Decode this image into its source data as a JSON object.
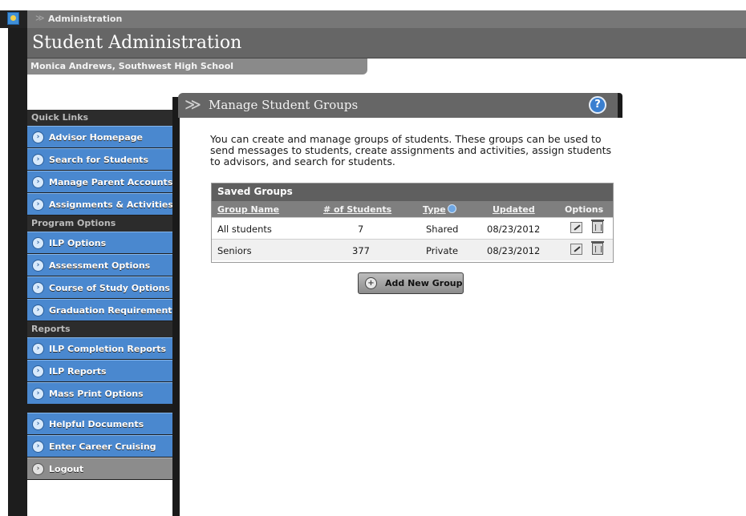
{
  "topbar": {
    "chevron": "≫",
    "title": "Administration",
    "icon": "app-icon"
  },
  "header": {
    "title": "Student Administration"
  },
  "user": {
    "name": "Monica Andrews, Southwest High School"
  },
  "sidebar": {
    "sections": [
      {
        "label": "Quick Links",
        "items": [
          {
            "label": "Advisor Homepage",
            "icon": "arrow-circle-icon"
          },
          {
            "label": "Search for Students",
            "icon": "arrow-circle-icon"
          },
          {
            "label": "Manage Parent Accounts",
            "icon": "arrow-circle-icon"
          },
          {
            "label": "Assignments & Activities",
            "icon": "arrow-circle-icon"
          }
        ]
      },
      {
        "label": "Program Options",
        "items": [
          {
            "label": "ILP Options",
            "icon": "arrow-circle-icon"
          },
          {
            "label": "Assessment Options",
            "icon": "arrow-circle-icon"
          },
          {
            "label": "Course of Study Options",
            "icon": "arrow-circle-icon"
          },
          {
            "label": "Graduation Requirements",
            "icon": "arrow-circle-icon"
          }
        ]
      },
      {
        "label": "Reports",
        "items": [
          {
            "label": "ILP Completion Reports",
            "icon": "arrow-circle-icon"
          },
          {
            "label": "ILP Reports",
            "icon": "arrow-circle-icon"
          },
          {
            "label": "Mass Print Options",
            "icon": "arrow-circle-icon"
          }
        ]
      }
    ],
    "extra": [
      {
        "label": "Helpful Documents",
        "icon": "arrow-circle-icon"
      },
      {
        "label": "Enter Career Cruising",
        "icon": "arrow-circle-icon"
      }
    ],
    "logout": {
      "label": "Logout",
      "icon": "arrow-circle-icon"
    }
  },
  "panel": {
    "chevrons": "≫",
    "title": "Manage Student Groups",
    "help_icon": "?",
    "intro": "You can create and manage groups of students. These groups can be used to send messages to students, create assignments and activities, assign students to advisors, and search for students."
  },
  "groups": {
    "title": "Saved Groups",
    "columns": {
      "name": "Group Name",
      "count": "# of Students",
      "type": "Type",
      "updated": "Updated",
      "options": "Options"
    },
    "rows": [
      {
        "name": "All students",
        "count": "7",
        "type": "Shared",
        "updated": "08/23/2012"
      },
      {
        "name": "Seniors",
        "count": "377",
        "type": "Private",
        "updated": "08/23/2012"
      }
    ]
  },
  "add_button": {
    "label": "Add New Group",
    "icon": "+"
  },
  "colors": {
    "accent_blue": "#4a88cf",
    "header_gray": "#666666",
    "dark": "#1d1d1d"
  }
}
